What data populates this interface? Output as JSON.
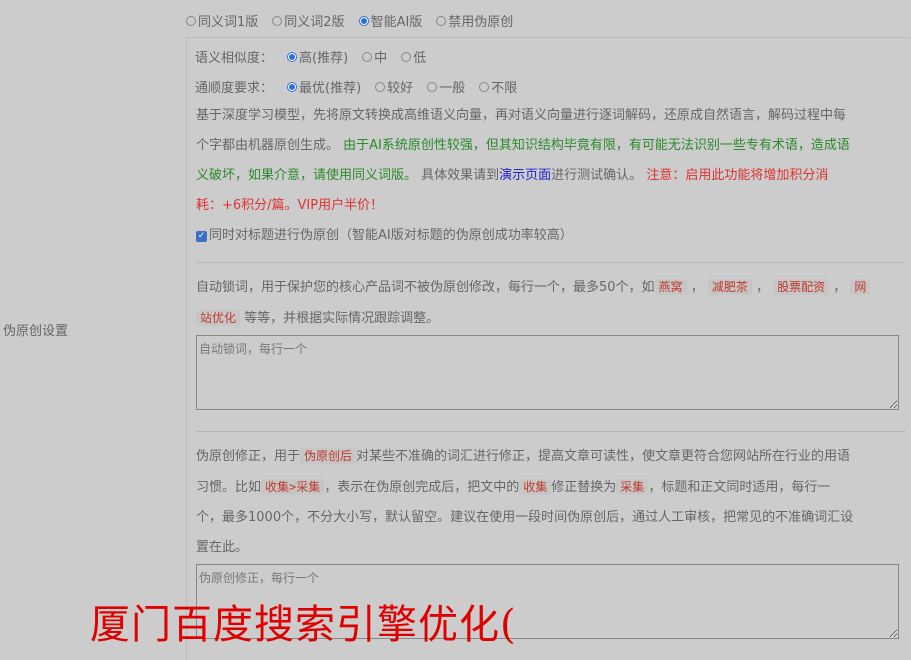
{
  "row_label": "伪原创设置",
  "version_options": [
    {
      "label": "同义词1版",
      "selected": false
    },
    {
      "label": "同义词2版",
      "selected": false
    },
    {
      "label": "智能AI版",
      "selected": true
    },
    {
      "label": "禁用伪原创",
      "selected": false
    }
  ],
  "similarity": {
    "label": "语义相似度：",
    "options": [
      {
        "label": "高(推荐)",
        "selected": true
      },
      {
        "label": "中",
        "selected": false
      },
      {
        "label": "低",
        "selected": false
      }
    ]
  },
  "fluency": {
    "label": "通顺度要求：",
    "options": [
      {
        "label": "最优(推荐)",
        "selected": true
      },
      {
        "label": "较好",
        "selected": false
      },
      {
        "label": "一般",
        "selected": false
      },
      {
        "label": "不限",
        "selected": false
      }
    ]
  },
  "desc": {
    "line1": "基于深度学习模型，先将原文转换成高维语义向量，再对语义向量进行逐词解码，还原成自然语言，解码过程中每",
    "line2_plain": "个字都由机器原创生成。 ",
    "line2_green": "由于AI系统原创性较强，但其知识结构毕竟有限，有可能无法识别一些专有术语，造成语",
    "line3_green": "义破坏，如果介意，请使用同义词版。",
    "line3_plain": " 具体效果请到",
    "line3_link": "演示页面",
    "line3_plain2": "进行测试确认。 ",
    "line3_red": "注意：启用此功能将增加积分消",
    "line4_red": "耗：+6积分/篇。VIP用户半价！"
  },
  "title_checkbox": {
    "label": "同时对标题进行伪原创（智能AI版对标题的伪原创成功率较高）",
    "checked": true
  },
  "lock": {
    "text1": "自动锁词，用于保护您的核心产品词不被伪原创修改，每行一个，最多50个，如",
    "tags": [
      "燕窝",
      "减肥茶",
      "股票配资",
      "网"
    ],
    "tag_last_line": "站优化",
    "text2": " 等等，并根据实际情况跟踪调整。",
    "placeholder": "自动锁词，每行一个"
  },
  "fix": {
    "t1": "伪原创修正，用于",
    "tag1": "伪原创后",
    "t2": "对某些不准确的词汇进行修正，提高文章可读性，使文章更符合您网站所在行业的用语",
    "t3": "习惯。比如",
    "tag2": "收集>采集",
    "t4": "，表示在伪原创完成后，把文中的",
    "tag3": "收集",
    "t5": "修正替换为",
    "tag4": "采集",
    "t6": "，标题和正文同时适用，每行一",
    "t7": "个，最多1000个，不分大小写，默认留空。建议在使用一段时间伪原创后，通过人工审核，把常见的不准确词汇设",
    "t8": "置在此。",
    "placeholder": "伪原创修正，每行一个"
  },
  "overlay_text": "厦门百度搜索引擎优化("
}
